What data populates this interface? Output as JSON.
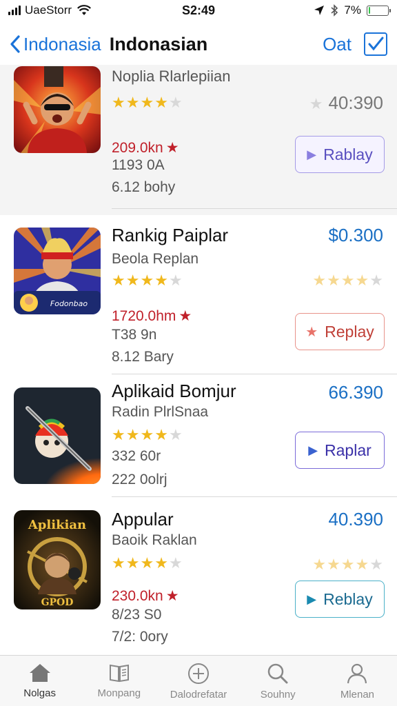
{
  "status_bar": {
    "carrier": "UaeStorr",
    "time": "S2:49",
    "battery": "7%",
    "battery_level": 0.07
  },
  "nav": {
    "back_label": "Indonasia",
    "title": "Indonasian",
    "action_label": "Oat"
  },
  "apps": [
    {
      "title": "",
      "subtitle": "Noplia Rlarlepiian",
      "rating": 4,
      "price": "40:390",
      "downloads": "209.0kn",
      "meta1": "1193 0A",
      "meta2": "6.12 bohy",
      "button_label": "Rablay"
    },
    {
      "title": "Rankig Paiplar",
      "subtitle": "Beola Replan",
      "rating": 3.5,
      "price": "$0.300",
      "downloads": "1720.0hm",
      "meta1": "T38 9n",
      "meta2": "8.12 Bary",
      "button_label": "Replay",
      "thumb_text": "Fodonbao"
    },
    {
      "title": "Aplikaid Bomjur",
      "subtitle": "Radin PlrlSnaa",
      "rating": 3.5,
      "price": "66.390",
      "meta1": "332 60r",
      "meta2": "222 0olrj",
      "button_label": "Raplar"
    },
    {
      "title": "Appular",
      "subtitle": "Baoik Raklan",
      "rating": 4,
      "price": "40.390",
      "downloads": "230.0kn",
      "meta1": "8/23 S0",
      "meta2": "7/2: 0ory",
      "button_label": "Reblay",
      "thumb_top": "Aplikian",
      "thumb_bottom": "GPOD"
    }
  ],
  "tabs": [
    {
      "label": "Nolgas",
      "icon": "home-icon"
    },
    {
      "label": "Monpang",
      "icon": "book-icon"
    },
    {
      "label": "Dalodrefatar",
      "icon": "plus-circle-icon"
    },
    {
      "label": "Souhny",
      "icon": "search-icon"
    },
    {
      "label": "Mlenan",
      "icon": "person-icon"
    }
  ],
  "colors": {
    "accent": "#1a73d9",
    "price_blue": "#1a6fc4",
    "star": "#f0b81c",
    "downloads_red": "#c0202a",
    "button_purple": "#8a7fe0",
    "button_red": "#e8736a",
    "button_teal": "#2aa6c8"
  }
}
